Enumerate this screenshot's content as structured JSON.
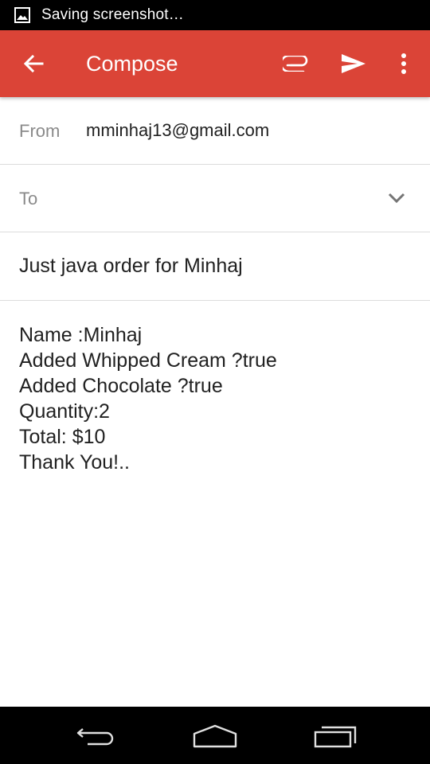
{
  "status_bar": {
    "text": "Saving screenshot…",
    "icon": "image-icon"
  },
  "app_bar": {
    "title": "Compose",
    "background": "#db4437",
    "back_icon": "arrow-back-icon",
    "attach_icon": "paperclip-icon",
    "send_icon": "send-icon",
    "more_icon": "more-vert-icon"
  },
  "from": {
    "label": "From",
    "value": "mminhaj13@gmail.com"
  },
  "to": {
    "label": "To",
    "value": "",
    "expand_icon": "chevron-down-icon"
  },
  "subject": "Just java order for Minhaj",
  "body_lines": [
    "Name :Minhaj",
    "Added Whipped Cream ?true",
    "Added Chocolate ?true",
    "Quantity:2",
    "Total: $10",
    "Thank You!.."
  ],
  "nav_bar": {
    "back_icon": "nav-back-icon",
    "home_icon": "nav-home-icon",
    "recents_icon": "nav-recents-icon"
  }
}
